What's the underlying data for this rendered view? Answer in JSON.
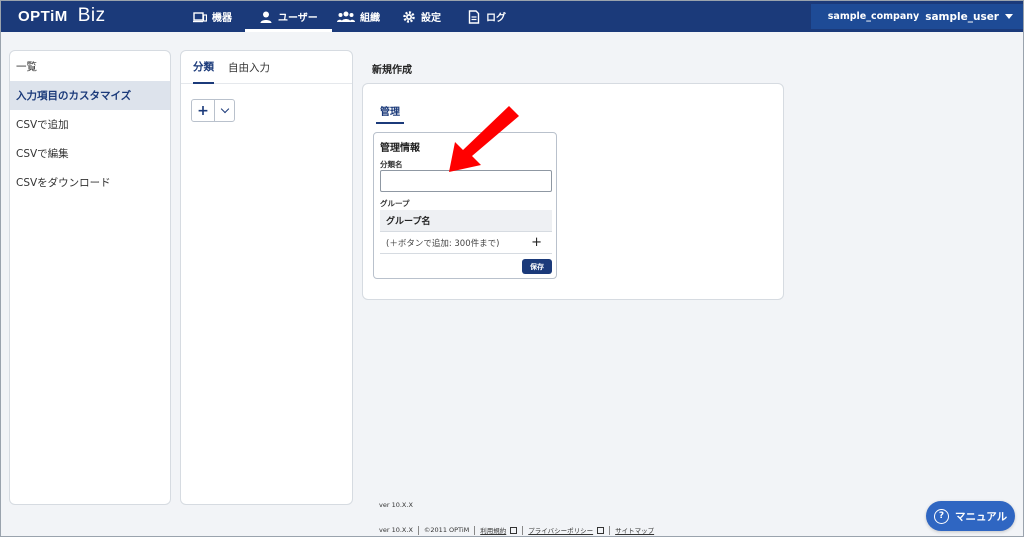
{
  "header": {
    "brand": "OPTiM",
    "brand_sub": "Biz",
    "nav": [
      {
        "label": "機器",
        "icon": "device-icon"
      },
      {
        "label": "ユーザー",
        "icon": "user-icon"
      },
      {
        "label": "組織",
        "icon": "organization-icon"
      },
      {
        "label": "設定",
        "icon": "gear-icon"
      },
      {
        "label": "ログ",
        "icon": "log-icon"
      }
    ],
    "company": "sample_company",
    "user": "sample_user"
  },
  "sidebar": {
    "items": [
      {
        "label": "一覧"
      },
      {
        "label": "入力項目のカスタマイズ"
      },
      {
        "label": "CSVで追加"
      },
      {
        "label": "CSVで編集"
      },
      {
        "label": "CSVをダウンロード"
      }
    ]
  },
  "category_panel": {
    "tabs": [
      {
        "label": "分類"
      },
      {
        "label": "自由入力"
      }
    ],
    "add_label": "+"
  },
  "main": {
    "title": "新規作成",
    "tab": "管理",
    "card": {
      "title": "管理情報",
      "field_label": "分類名",
      "group_label": "グループ",
      "grid_header": "グループ名",
      "grid_hint": "(＋ボタンで追加: 300件まで)",
      "add_symbol": "+",
      "save_label": "保存"
    }
  },
  "footer": {
    "version_top": "ver 10.X.X",
    "version": "ver 10.X.X",
    "copyright": "©2011 OPTiM",
    "terms": "利用規約",
    "privacy": "プライバシーポリシー",
    "sitemap": "サイトマップ"
  },
  "manual_button": {
    "label": "マニュアル",
    "icon_glyph": "?"
  },
  "colors": {
    "header_bg": "#1b3a7a",
    "account_bg": "#1e4b96",
    "accent": "#1b3a7a",
    "manual_bg": "#2f66c2",
    "arrow": "#ff0000"
  }
}
